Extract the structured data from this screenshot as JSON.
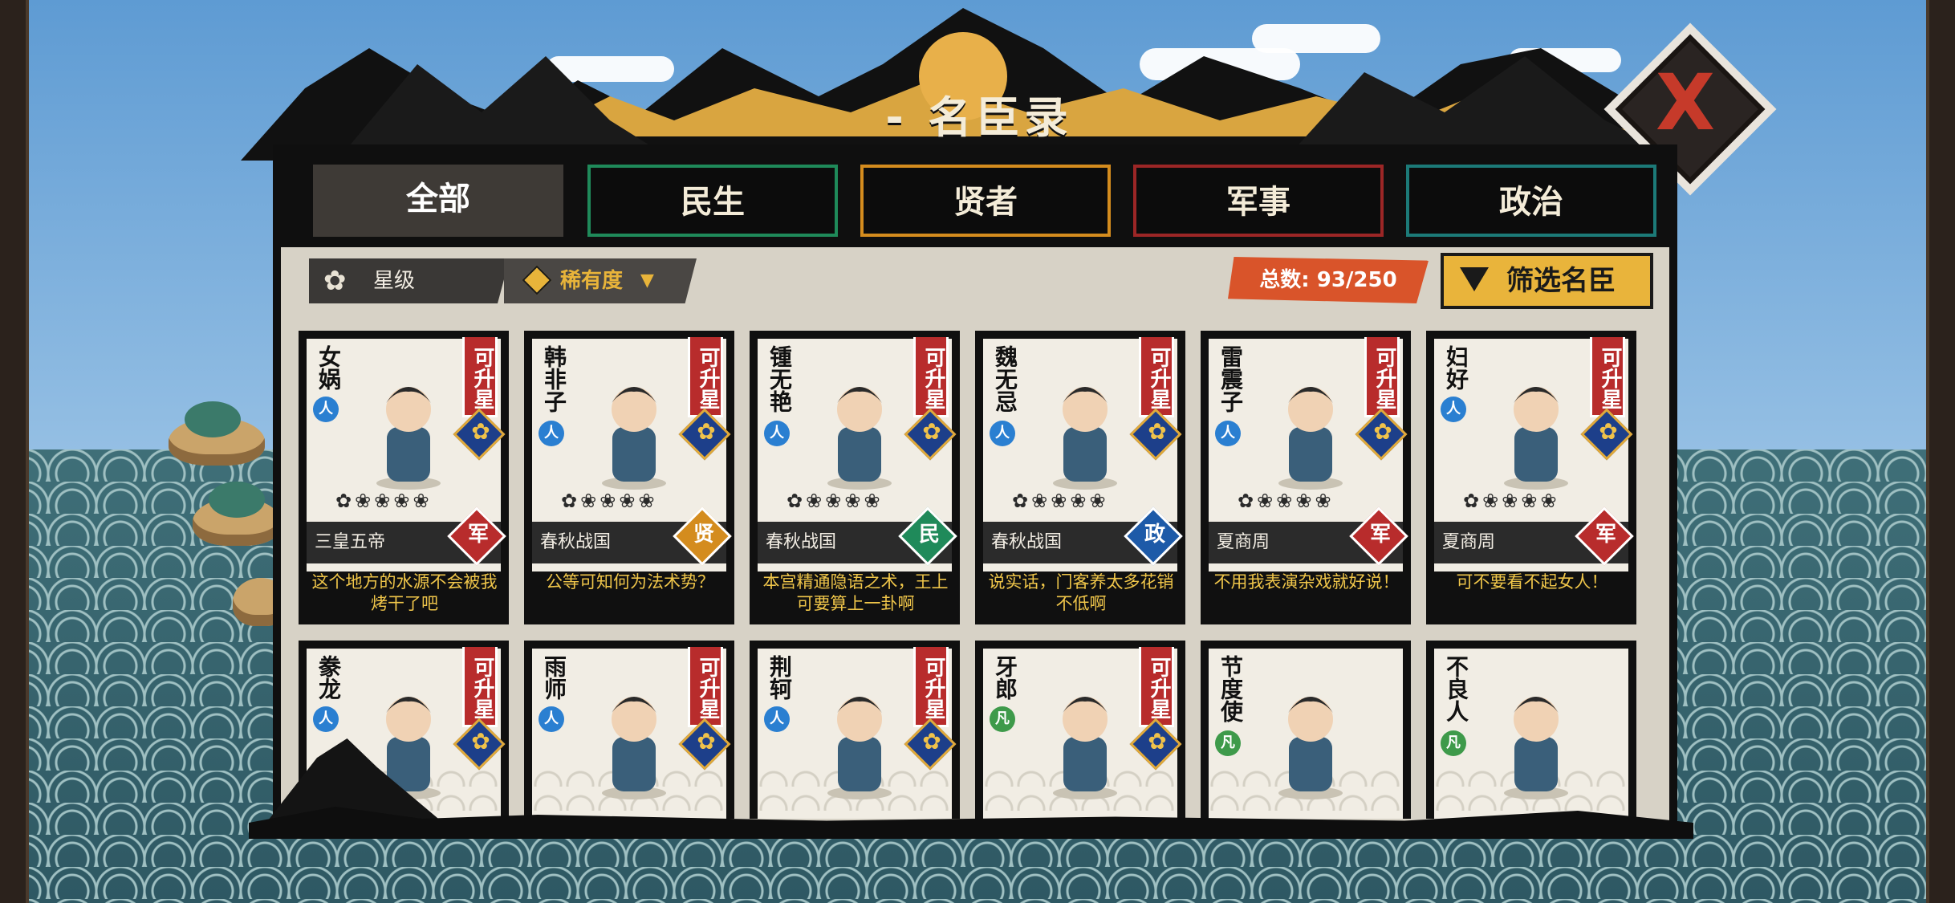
{
  "header": {
    "title": "- 名臣录 -",
    "close_label": "X"
  },
  "tabs": [
    {
      "label": "全部",
      "color": "#3e3a36",
      "active": true
    },
    {
      "label": "民生",
      "color": "#1f8a5a",
      "active": false
    },
    {
      "label": "贤者",
      "color": "#d48c1e",
      "active": false
    },
    {
      "label": "军事",
      "color": "#9c2626",
      "active": false
    },
    {
      "label": "政治",
      "color": "#1c7a78",
      "active": false
    }
  ],
  "toolbar": {
    "star_sort_label": "星级",
    "rarity_sort_label": "稀有度",
    "total_label": "总数: 93/250",
    "filter_label": "筛选名臣"
  },
  "cards_row1": [
    {
      "name": "女娲",
      "badge": "人",
      "upgrade": "可升星",
      "era": "三皇五帝",
      "role": "军",
      "role_color": "#b82c2c",
      "quote": "这个地方的水源不会被我烤干了吧",
      "stars": 1
    },
    {
      "name": "韩非子",
      "badge": "人",
      "upgrade": "可升星",
      "era": "春秋战国",
      "role": "贤",
      "role_color": "#d48c1e",
      "quote": "公等可知何为法术势？",
      "stars": 1
    },
    {
      "name": "锺无艳",
      "badge": "人",
      "upgrade": "可升星",
      "era": "春秋战国",
      "role": "民",
      "role_color": "#1f8a5a",
      "quote": "本宫精通隐语之术，王上可要算上一卦啊",
      "stars": 1
    },
    {
      "name": "魏无忌",
      "badge": "人",
      "upgrade": "可升星",
      "era": "春秋战国",
      "role": "政",
      "role_color": "#1d5aa8",
      "quote": "说实话，门客养太多花销不低啊",
      "stars": 1
    },
    {
      "name": "雷震子",
      "badge": "人",
      "upgrade": "可升星",
      "era": "夏商周",
      "role": "军",
      "role_color": "#b82c2c",
      "quote": "不用我表演杂戏就好说！",
      "stars": 1
    },
    {
      "name": "妇好",
      "badge": "人",
      "upgrade": "可升星",
      "era": "夏商周",
      "role": "军",
      "role_color": "#b82c2c",
      "quote": "可不要看不起女人！",
      "stars": 1
    }
  ],
  "cards_row2": [
    {
      "name": "豢龙",
      "badge": "人",
      "badge_color": "#2a7fd1",
      "upgrade": "可升星"
    },
    {
      "name": "雨师",
      "badge": "人",
      "badge_color": "#2a7fd1",
      "upgrade": "可升星"
    },
    {
      "name": "荆轲",
      "badge": "人",
      "badge_color": "#2a7fd1",
      "upgrade": "可升星"
    },
    {
      "name": "牙郎",
      "badge": "凡",
      "badge_color": "#3e9a4a",
      "upgrade": "可升星"
    },
    {
      "name": "节度使",
      "badge": "凡",
      "badge_color": "#3e9a4a",
      "upgrade": ""
    },
    {
      "name": "不良人",
      "badge": "凡",
      "badge_color": "#3e9a4a",
      "upgrade": ""
    }
  ],
  "icons": {
    "star_sort": "flower-icon",
    "rarity_sort": "diamond-icon",
    "filter": "funnel-icon",
    "close": "close-icon"
  }
}
